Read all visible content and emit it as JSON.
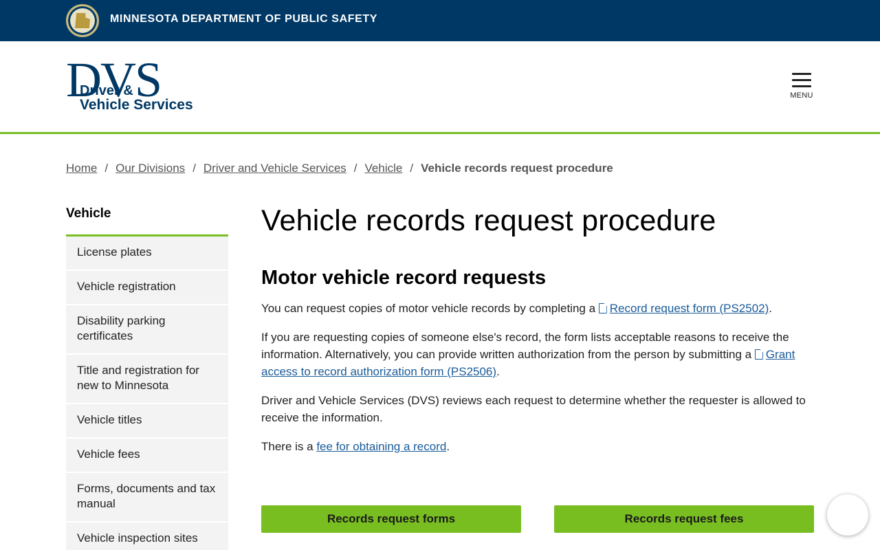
{
  "topbar": {
    "agency": "MINNESOTA DEPARTMENT OF PUBLIC SAFETY",
    "seal_icon": "state-seal-icon",
    "background": "#003865"
  },
  "header": {
    "logo": {
      "letters": "DVS",
      "line1": "Driver &",
      "line2": "Vehicle Services"
    },
    "menu_label": "MENU",
    "accent": "#78be21"
  },
  "breadcrumb": {
    "items": [
      "Home",
      "Our Divisions",
      "Driver and Vehicle Services",
      "Vehicle"
    ],
    "separator": "/",
    "current": "Vehicle records request procedure"
  },
  "sidebar": {
    "title": "Vehicle",
    "items": [
      "License plates",
      "Vehicle registration",
      "Disability parking certificates",
      "Title and registration for new to Minnesota",
      "Vehicle titles",
      "Vehicle fees",
      "Forms, documents and tax manual",
      "Vehicle inspection sites"
    ]
  },
  "main": {
    "title": "Vehicle records request procedure",
    "section_title": "Motor vehicle record requests",
    "p1": {
      "text": "You can request copies of motor vehicle records by completing a ",
      "link": "Record request form (PS2502)",
      "end": "."
    },
    "p2": {
      "text": "If you are requesting copies of someone else's record, the form lists acceptable reasons to receive the information. Alternatively, you can provide written authorization from the person by submitting a ",
      "link": "Grant access to record authorization form (PS2506)",
      "end": "."
    },
    "p3": {
      "text": "Driver and Vehicle Services (DVS) reviews each request to determine whether the requester is allowed to receive the information."
    },
    "p4": {
      "text": "There is a ",
      "link": "fee for obtaining a record",
      "end": "."
    },
    "buttons": [
      "Records request forms",
      "Records request fees"
    ],
    "link_color": "#1a5b9a",
    "button_color": "#78be21"
  }
}
